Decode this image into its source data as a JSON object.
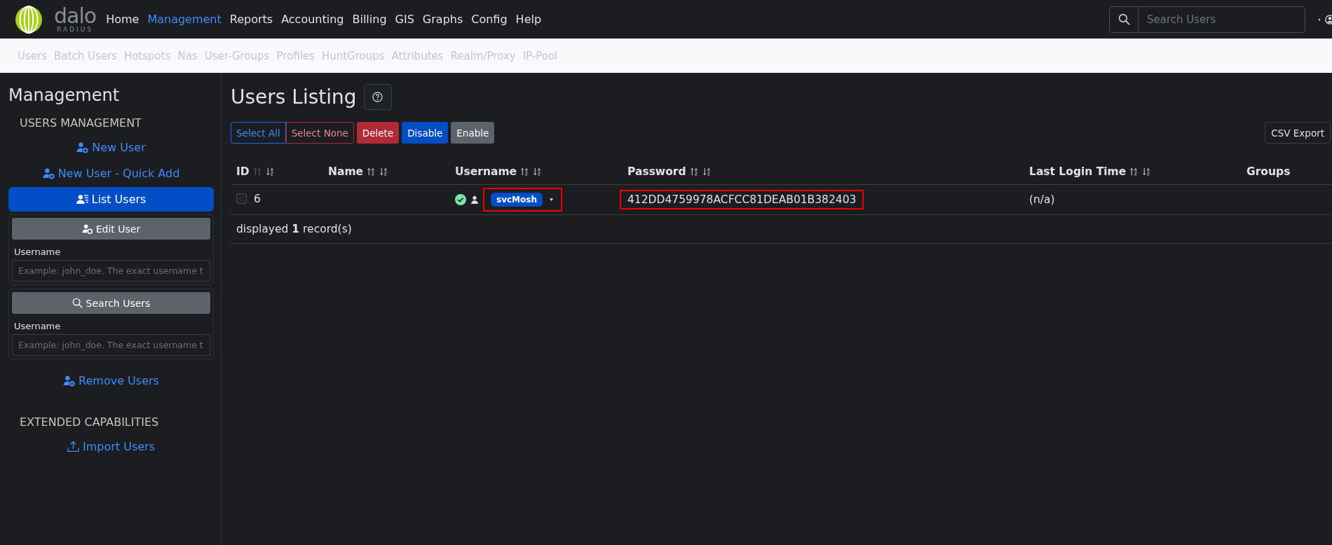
{
  "logo": {
    "wordmark": "dalo",
    "subtitle": "RADIUS"
  },
  "nav": [
    {
      "label": "Home",
      "selected": false
    },
    {
      "label": "Management",
      "selected": true
    },
    {
      "label": "Reports",
      "selected": false
    },
    {
      "label": "Accounting",
      "selected": false
    },
    {
      "label": "Billing",
      "selected": false
    },
    {
      "label": "GIS",
      "selected": false
    },
    {
      "label": "Graphs",
      "selected": false
    },
    {
      "label": "Config",
      "selected": false
    },
    {
      "label": "Help",
      "selected": false
    }
  ],
  "search": {
    "placeholder": "Search Users"
  },
  "subnav": [
    "Users",
    "Batch Users",
    "Hotspots",
    "Nas",
    "User-Groups",
    "Profiles",
    "HuntGroups",
    "Attributes",
    "Realm/Proxy",
    "IP-Pool"
  ],
  "sidebar": {
    "title": "Management",
    "sections": [
      {
        "heading": "USERS MANAGEMENT",
        "items": [
          {
            "kind": "link",
            "label": "New User",
            "selected": false
          },
          {
            "kind": "link",
            "label": "New User - Quick Add",
            "selected": false
          },
          {
            "kind": "link",
            "label": "List Users",
            "selected": true
          },
          {
            "kind": "form",
            "button": "Edit User",
            "field_label": "Username",
            "placeholder": "Example: john_doe. The exact username t"
          },
          {
            "kind": "form",
            "button": "Search Users",
            "field_label": "Username",
            "placeholder": "Example: john_doe. The exact username t"
          },
          {
            "kind": "link",
            "label": "Remove Users",
            "selected": false
          }
        ]
      },
      {
        "heading": "EXTENDED CAPABILITIES",
        "items": [
          {
            "kind": "link",
            "label": "Import Users",
            "selected": false
          }
        ]
      }
    ]
  },
  "page": {
    "title": "Users Listing",
    "actions": [
      {
        "label": "Select All",
        "kind": "outline-primary"
      },
      {
        "label": "Select None",
        "kind": "outline-danger"
      },
      {
        "label": "Delete",
        "kind": "danger"
      },
      {
        "label": "Disable",
        "kind": "primary"
      },
      {
        "label": "Enable",
        "kind": "secondary"
      }
    ],
    "export_button": "CSV Export"
  },
  "table": {
    "columns": [
      {
        "label": "ID",
        "sortable": true,
        "asc_muted": true
      },
      {
        "label": "Name",
        "sortable": true,
        "asc_muted": false
      },
      {
        "label": "Username",
        "sortable": true,
        "asc_muted": false
      },
      {
        "label": "Password",
        "sortable": true,
        "asc_muted": false
      },
      {
        "label": "Last Login Time",
        "sortable": true,
        "asc_muted": false
      },
      {
        "label": "Groups",
        "sortable": false
      }
    ],
    "rows": [
      {
        "checked": false,
        "id": "6",
        "enabled": true,
        "username": "svcMosh",
        "username_highlighted": true,
        "password": "412DD4759978ACFCC81DEAB01B382403",
        "password_highlighted": true,
        "last_login": "(n/a)"
      }
    ],
    "footer": {
      "before": "displayed",
      "count": "1",
      "after": "record(s)"
    }
  }
}
